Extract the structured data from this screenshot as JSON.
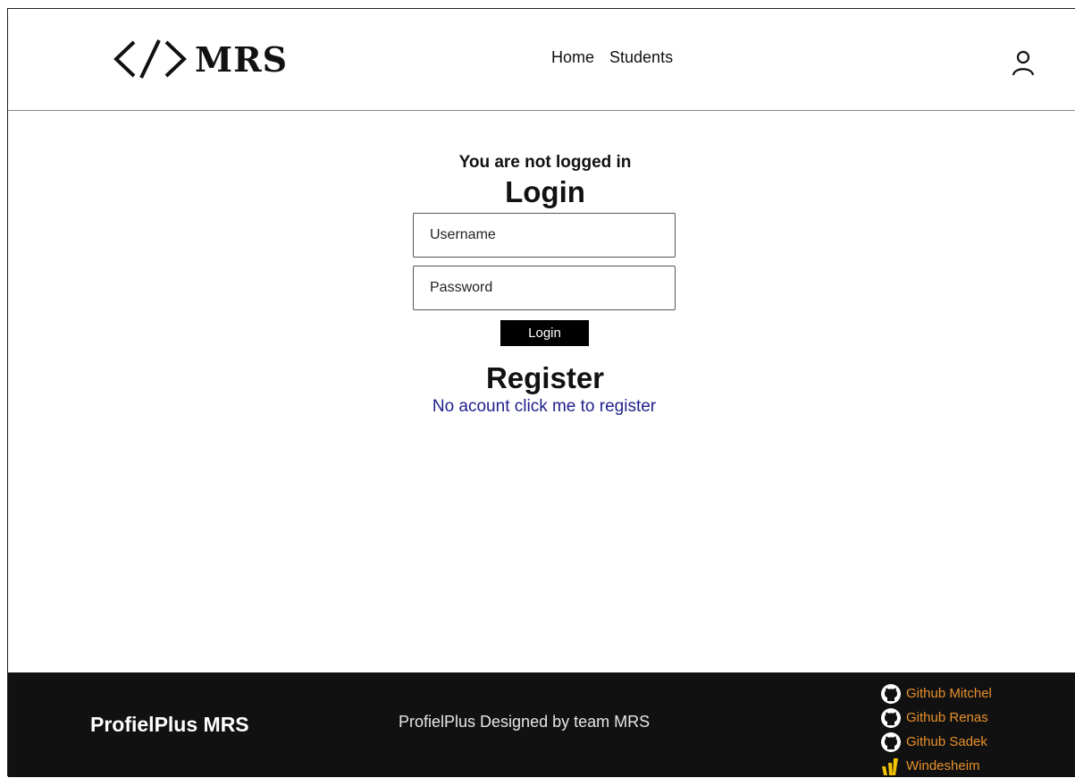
{
  "brand": {
    "logo_text": "MRS"
  },
  "nav": {
    "items": [
      "Home",
      "Students"
    ]
  },
  "login": {
    "status": "You are not logged in",
    "heading": "Login",
    "username_placeholder": "Username",
    "password_placeholder": "Password",
    "button": "Login"
  },
  "register": {
    "heading": "Register",
    "link": "No acount click me to register"
  },
  "footer": {
    "brand": "ProfielPlus MRS",
    "tagline": "ProfielPlus Designed by team MRS",
    "links": [
      {
        "label": "Github Mitchel",
        "icon": "github-icon"
      },
      {
        "label": "Github Renas",
        "icon": "github-icon"
      },
      {
        "label": "Github Sadek",
        "icon": "github-icon"
      },
      {
        "label": "Windesheim",
        "icon": "windesheim-icon"
      }
    ]
  },
  "colors": {
    "footer_bg": "#111111",
    "footer_link": "#e8902c",
    "register_link": "#1f1f8c",
    "windesheim": "#f2c200"
  }
}
